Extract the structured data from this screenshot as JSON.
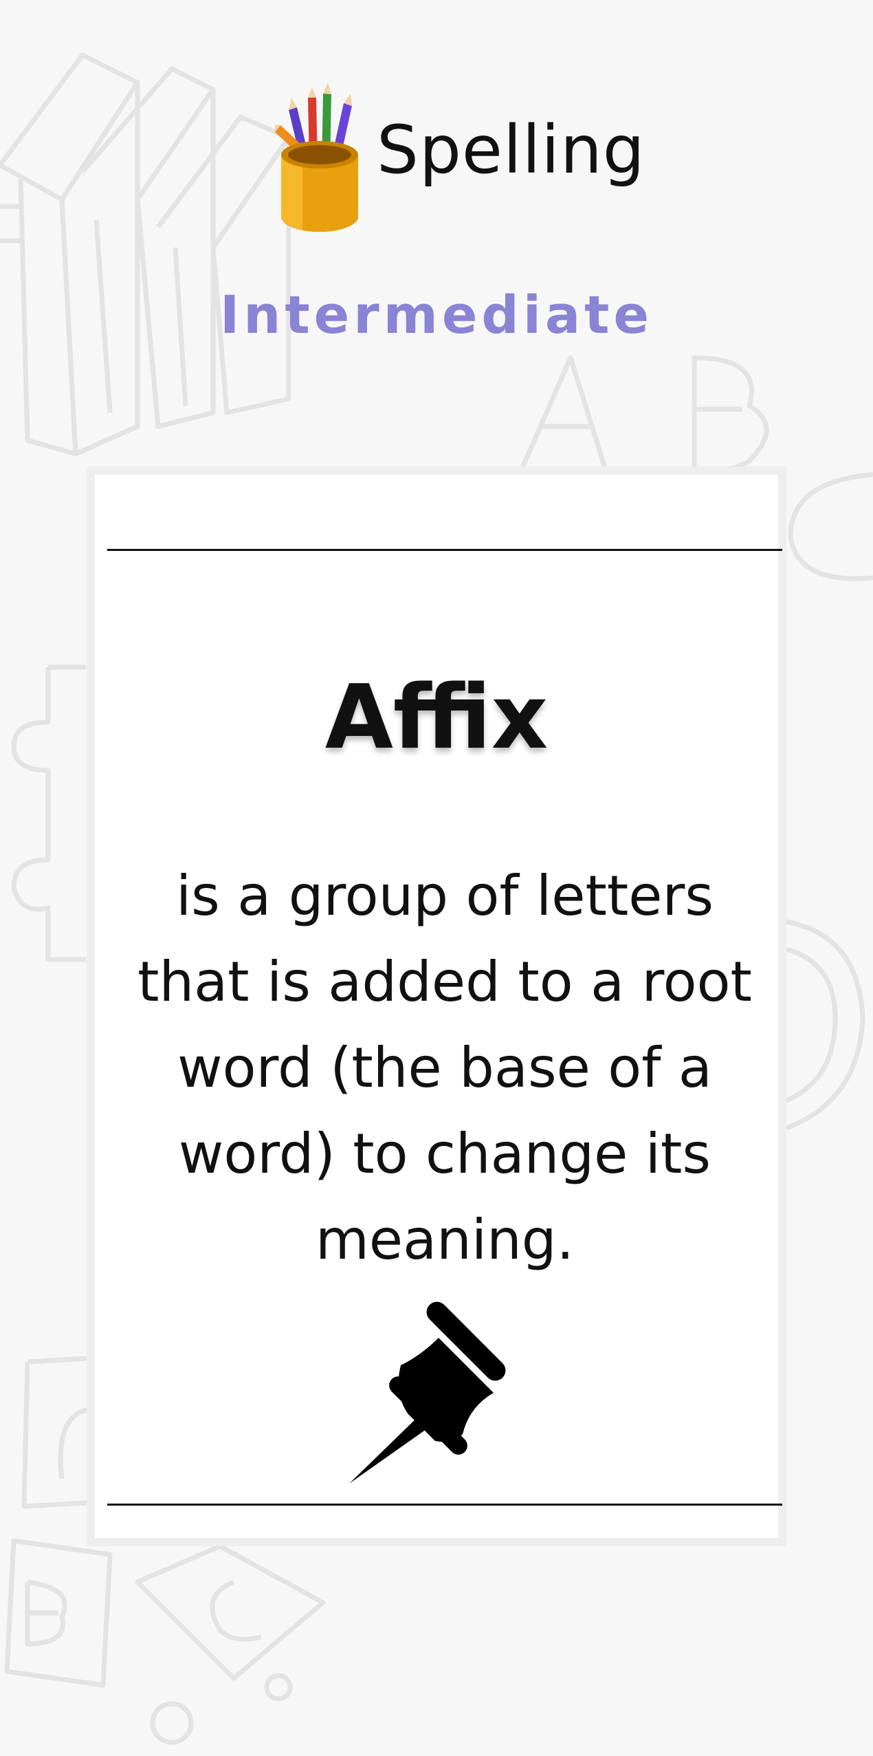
{
  "header": {
    "title": "Spelling",
    "logo_icon": "pencil-cup-icon"
  },
  "level": "Intermediate",
  "card": {
    "word": "Affix",
    "definition": " is a group of letters that is added to a root word (the base of a word) to change its meaning.",
    "pin_icon": "pushpin-icon"
  },
  "colors": {
    "background": "#f7f7f7",
    "level_text": "#8a84d4",
    "card_border": "#eeeeee",
    "text": "#111111"
  }
}
